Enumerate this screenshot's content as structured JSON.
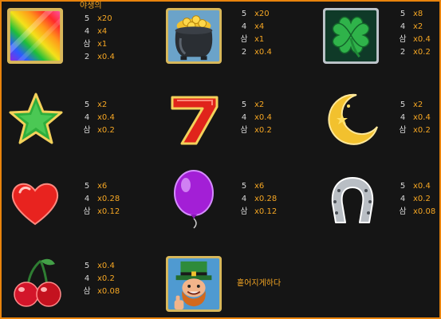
{
  "colors": {
    "accent": "#f5a623",
    "border": "#e8830c",
    "background": "#151515",
    "count_text": "#d8d8d8"
  },
  "wild_label": "야생의",
  "scatter_label": "흩어지게하다",
  "symbols": [
    {
      "name": "rainbow-wild",
      "icon": "rainbow-icon",
      "pays": [
        {
          "count": "5",
          "mult": "x20"
        },
        {
          "count": "4",
          "mult": "x4"
        },
        {
          "count": "삼",
          "mult": "x1"
        },
        {
          "count": "2",
          "mult": "x0.4"
        }
      ]
    },
    {
      "name": "pot-of-gold",
      "icon": "pot-of-gold-icon",
      "pays": [
        {
          "count": "5",
          "mult": "x20"
        },
        {
          "count": "4",
          "mult": "x4"
        },
        {
          "count": "삼",
          "mult": "x1"
        },
        {
          "count": "2",
          "mult": "x0.4"
        }
      ]
    },
    {
      "name": "clover",
      "icon": "four-leaf-clover-icon",
      "pays": [
        {
          "count": "5",
          "mult": "x8"
        },
        {
          "count": "4",
          "mult": "x2"
        },
        {
          "count": "삼",
          "mult": "x0.4"
        },
        {
          "count": "2",
          "mult": "x0.2"
        }
      ]
    },
    {
      "name": "star",
      "icon": "star-icon",
      "pays": [
        {
          "count": "5",
          "mult": "x2"
        },
        {
          "count": "4",
          "mult": "x0.4"
        },
        {
          "count": "삼",
          "mult": "x0.2"
        }
      ]
    },
    {
      "name": "seven",
      "icon": "seven-icon",
      "pays": [
        {
          "count": "5",
          "mult": "x2"
        },
        {
          "count": "4",
          "mult": "x0.4"
        },
        {
          "count": "삼",
          "mult": "x0.2"
        }
      ]
    },
    {
      "name": "moon",
      "icon": "crescent-moon-icon",
      "pays": [
        {
          "count": "5",
          "mult": "x2"
        },
        {
          "count": "4",
          "mult": "x0.4"
        },
        {
          "count": "삼",
          "mult": "x0.2"
        }
      ]
    },
    {
      "name": "heart",
      "icon": "heart-icon",
      "pays": [
        {
          "count": "5",
          "mult": "x6"
        },
        {
          "count": "4",
          "mult": "x0.28"
        },
        {
          "count": "삼",
          "mult": "x0.12"
        }
      ]
    },
    {
      "name": "balloon",
      "icon": "balloon-icon",
      "pays": [
        {
          "count": "5",
          "mult": "x6"
        },
        {
          "count": "4",
          "mult": "x0.28"
        },
        {
          "count": "삼",
          "mult": "x0.12"
        }
      ]
    },
    {
      "name": "horseshoe",
      "icon": "horseshoe-icon",
      "pays": [
        {
          "count": "5",
          "mult": "x0.4"
        },
        {
          "count": "4",
          "mult": "x0.2"
        },
        {
          "count": "삼",
          "mult": "x0.08"
        }
      ]
    },
    {
      "name": "cherry",
      "icon": "cherry-icon",
      "pays": [
        {
          "count": "5",
          "mult": "x0.4"
        },
        {
          "count": "4",
          "mult": "x0.2"
        },
        {
          "count": "삼",
          "mult": "x0.08"
        }
      ]
    },
    {
      "name": "leprechaun-scatter",
      "icon": "leprechaun-icon",
      "pays": []
    }
  ]
}
